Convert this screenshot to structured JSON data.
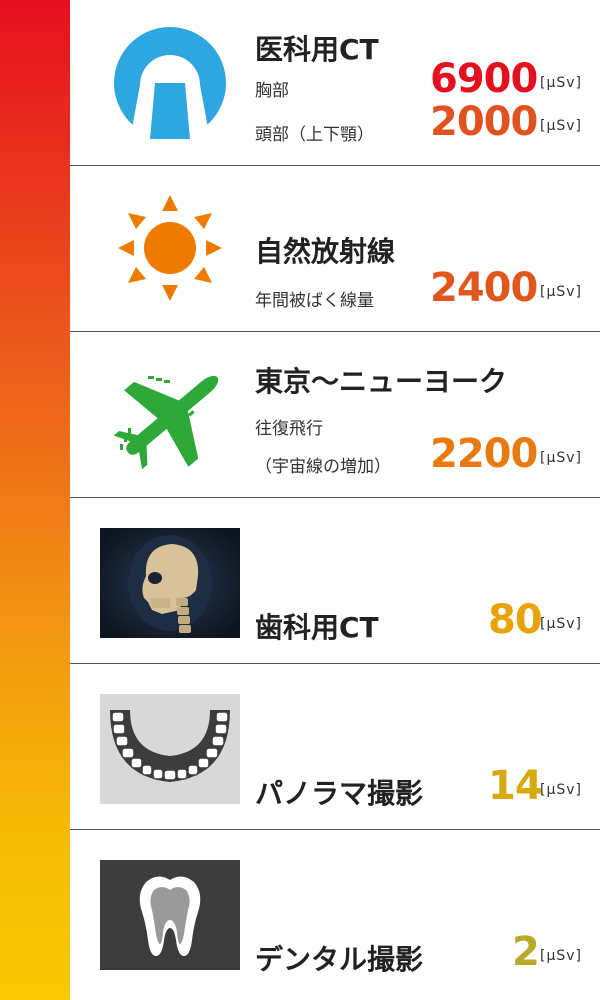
{
  "items": [
    {
      "title": "医科用CT",
      "icon": "ct-scanner-icon",
      "measures": [
        {
          "label": "胸部",
          "value": "6900",
          "unit": "[μSv]",
          "color": "#e60f1f"
        },
        {
          "label": "頭部（上下顎）",
          "value": "2000",
          "unit": "[μSv]",
          "color": "#e0521f"
        }
      ]
    },
    {
      "title": "自然放射線",
      "icon": "sun-icon",
      "measures": [
        {
          "label": "年間被ばく線量",
          "value": "2400",
          "unit": "[μSv]",
          "color": "#e0561c"
        }
      ]
    },
    {
      "title": "東京〜ニューヨーク",
      "icon": "airplane-icon",
      "measures": [
        {
          "label_line1": "往復飛行",
          "label_line2": "（宇宙線の増加）",
          "value": "2200",
          "unit": "[μSv]",
          "color": "#e87a10"
        }
      ]
    },
    {
      "title": "歯科用CT",
      "icon": "skull-xray-icon",
      "measures": [
        {
          "value": "80",
          "unit": "[μSv]",
          "color": "#e8a308"
        }
      ]
    },
    {
      "title": "パノラマ撮影",
      "icon": "dental-arch-icon",
      "measures": [
        {
          "value": "14",
          "unit": "[μSv]",
          "color": "#d6aa0c"
        }
      ]
    },
    {
      "title": "デンタル撮影",
      "icon": "tooth-icon",
      "measures": [
        {
          "value": "2",
          "unit": "[μSv]",
          "color": "#b8a92a"
        }
      ]
    }
  ]
}
